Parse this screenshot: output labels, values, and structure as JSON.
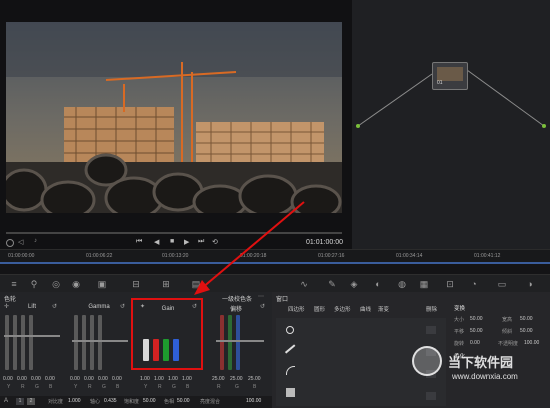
{
  "viewer": {
    "timecode": "01:01:00:00",
    "transport_icons": [
      "skip-back-icon",
      "step-back-icon",
      "stop-icon",
      "play-icon",
      "step-forward-icon",
      "loop-icon"
    ]
  },
  "node": {
    "label": "01"
  },
  "timeline": {
    "ticks": [
      "01:00:00:00",
      "01:00:06:22",
      "01:00:13:20",
      "01:00:20:18",
      "01:00:27:16",
      "01:00:34:14",
      "01:00:41:12"
    ]
  },
  "color": {
    "panel_label": "色轮",
    "mode_label": "一级校色条",
    "wheels": [
      {
        "label": "Lift",
        "values": [
          "0.00",
          "0.00",
          "0.00",
          "0.00"
        ]
      },
      {
        "label": "Gamma",
        "values": [
          "0.00",
          "0.00",
          "0.00",
          "0.00"
        ]
      },
      {
        "label": "Gain",
        "values": [
          "1.00",
          "1.00",
          "1.00",
          "1.00"
        ]
      },
      {
        "label": "偏移",
        "values": [
          "25.00",
          "25.00",
          "25.00"
        ]
      }
    ],
    "channel_letters": [
      "Y",
      "R",
      "G",
      "B"
    ],
    "offset_letters": [
      "R",
      "G",
      "B"
    ]
  },
  "window_panel": {
    "title": "窗口",
    "tools": [
      "四边形",
      "圆形",
      "多边形",
      "曲线",
      "渐变"
    ],
    "delete_label": "删除",
    "transform_label": "变换",
    "soften_label": "柔化",
    "transform_fields": [
      "大小",
      "50.00",
      "宽高",
      "50.00",
      "平移",
      "50.00",
      "倾斜",
      "50.00",
      "旋转",
      "0.00",
      "不透明度",
      "100.00"
    ]
  },
  "bottom": {
    "items": [
      {
        "label": "对比度",
        "value": "1.000"
      },
      {
        "label": "轴心",
        "value": "0.435"
      },
      {
        "label": "饱和度",
        "value": "50.00"
      },
      {
        "label": "色相",
        "value": "50.00"
      },
      {
        "label": "亮度混合",
        "value": "100.00"
      }
    ],
    "pages": [
      "1",
      "2"
    ]
  },
  "watermark": {
    "cn": "当下软件园",
    "url": "www.downxia.com"
  },
  "colors": {
    "accent_red": "#e01010",
    "blue_timeline": "#3a5d9c"
  }
}
